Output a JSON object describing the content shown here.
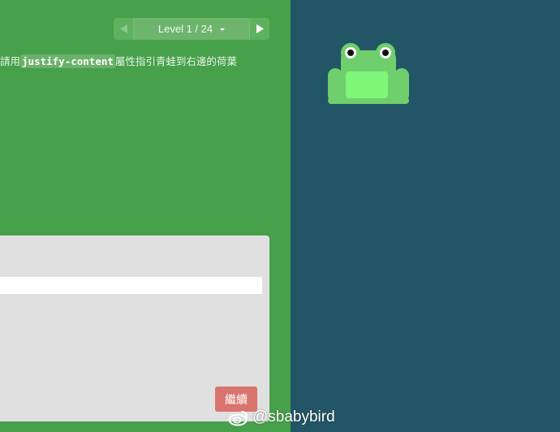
{
  "level": {
    "label": "Level 1 / 24",
    "prev_icon": "triangle-left-icon",
    "next_icon": "triangle-right-icon",
    "caret_icon": "caret-down-icon"
  },
  "instruction": {
    "before": "請用",
    "code": "justify-content",
    "after": "屬性指引青蛙到右邊的荷葉"
  },
  "editor": {
    "input_value": ""
  },
  "continue_button": {
    "label": "繼續"
  },
  "board": {
    "frog_color": "#6fcf6d",
    "frog_belly_color": "#7ef77b",
    "pond_color": "#225566"
  },
  "watermark": {
    "icon": "weibo-icon",
    "text": "@sbabybird"
  },
  "colors": {
    "panel_green": "#47a04a",
    "button_red": "#d9746e",
    "editor_grey": "#e0e0e0"
  }
}
